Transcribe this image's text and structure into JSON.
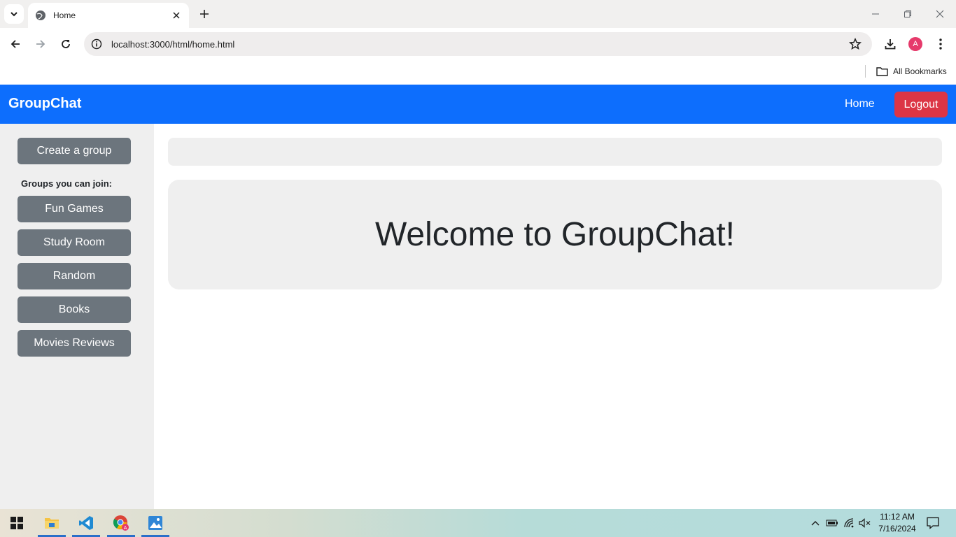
{
  "browser": {
    "tab_title": "Home",
    "url": "localhost:3000/html/home.html",
    "profile_initial": "A",
    "bookmarks_label": "All Bookmarks"
  },
  "navbar": {
    "brand": "GroupChat",
    "home_label": "Home",
    "logout_label": "Logout"
  },
  "sidebar": {
    "create_label": "Create a group",
    "groups_heading": "Groups you can join:",
    "groups": [
      {
        "label": "Fun Games"
      },
      {
        "label": "Study Room"
      },
      {
        "label": "Random"
      },
      {
        "label": "Books"
      },
      {
        "label": "Movies Reviews"
      }
    ]
  },
  "main": {
    "welcome": "Welcome to GroupChat!"
  },
  "taskbar": {
    "time": "11:12 AM",
    "date": "7/16/2024"
  },
  "colors": {
    "navbar": "#0d6efd",
    "logout": "#dc3545",
    "sidebar_button": "#6c757d",
    "panel": "#efefef"
  }
}
